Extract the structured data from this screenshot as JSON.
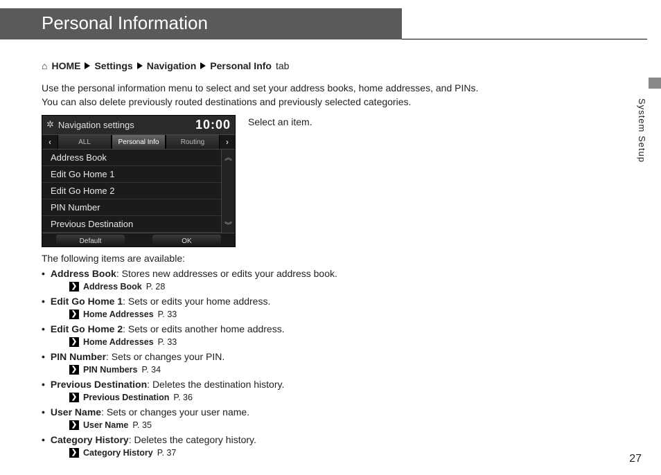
{
  "header": {
    "title": "Personal Information"
  },
  "breadcrumb": {
    "home": "HOME",
    "settings": "Settings",
    "navigation": "Navigation",
    "personal": "Personal Info",
    "suffix": "tab"
  },
  "intro": "Use the personal information menu to select and set your address books, home addresses, and PINs. You can also delete previously routed destinations and previously selected categories.",
  "device": {
    "title": "Navigation settings",
    "time": "10:00",
    "tabs": {
      "all": "ALL",
      "personal": "Personal Info",
      "routing": "Routing"
    },
    "items": [
      "Address Book",
      "Edit Go Home 1",
      "Edit Go Home 2",
      "PIN Number",
      "Previous Destination"
    ],
    "buttons": {
      "default": "Default",
      "ok": "OK"
    }
  },
  "instruction": "Select an item.",
  "available_intro": "The following items are available:",
  "items": [
    {
      "name": "Address Book",
      "desc": ": Stores new addresses or edits your address book.",
      "xref_name": "Address Book",
      "xref_page": "P. 28"
    },
    {
      "name": "Edit Go Home 1",
      "desc": ": Sets or edits your home address.",
      "xref_name": "Home Addresses",
      "xref_page": "P. 33"
    },
    {
      "name": "Edit Go Home 2",
      "desc": ": Sets or edits another home address.",
      "xref_name": "Home Addresses",
      "xref_page": "P. 33"
    },
    {
      "name": "PIN Number",
      "desc": ": Sets or changes your PIN.",
      "xref_name": "PIN Numbers",
      "xref_page": "P. 34"
    },
    {
      "name": "Previous Destination",
      "desc": ": Deletes the destination history.",
      "xref_name": "Previous Destination",
      "xref_page": "P. 36"
    },
    {
      "name": "User Name",
      "desc": ": Sets or changes your user name.",
      "xref_name": "User Name",
      "xref_page": "P. 35"
    },
    {
      "name": "Category History",
      "desc": ": Deletes the category history.",
      "xref_name": "Category History",
      "xref_page": "P. 37"
    }
  ],
  "side_label": "System Setup",
  "page_number": "27"
}
